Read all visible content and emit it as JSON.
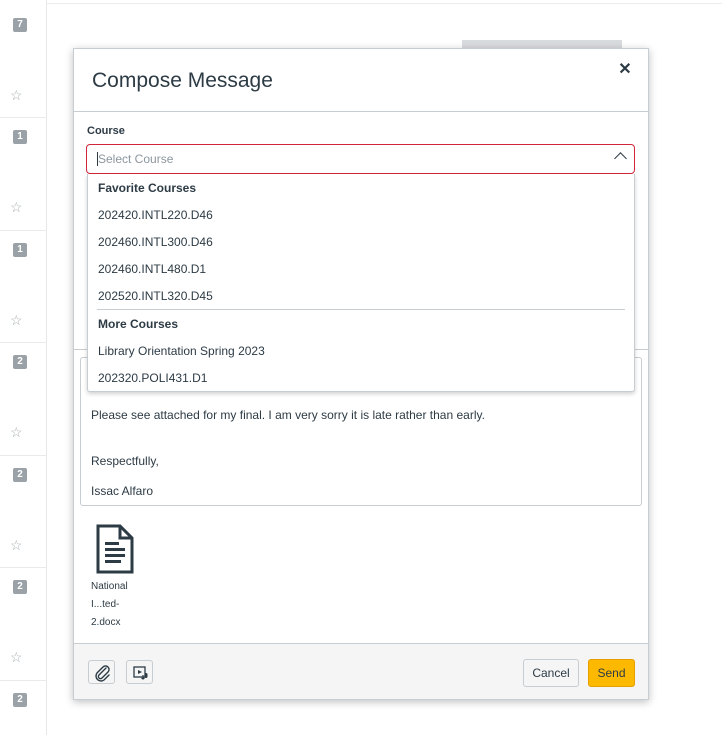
{
  "background": {
    "badges": [
      "7",
      "1",
      "1",
      "2",
      "2",
      "2",
      "2"
    ],
    "star_icon": "star-outline-icon"
  },
  "modal": {
    "title": "Compose Message",
    "close_icon": "close-icon"
  },
  "course": {
    "label": "Course",
    "placeholder": "Select Course"
  },
  "dropdown": {
    "groups": [
      {
        "label": "Favorite Courses",
        "items": [
          "202420.INTL220.D46",
          "202460.INTL300.D46",
          "202460.INTL480.D1",
          "202520.INTL320.D45"
        ]
      },
      {
        "label": "More Courses",
        "items": [
          "Library Orientation Spring 2023",
          "202320.POLI431.D1"
        ]
      }
    ]
  },
  "message": {
    "lines": [
      "Please see attached for my final. I am very sorry it is late rather than early.",
      "Respectfully,",
      "Issac Alfaro"
    ]
  },
  "attachment": {
    "icon": "document-icon",
    "name_lines": [
      "National",
      "I...ted-",
      "2.docx"
    ]
  },
  "footer": {
    "attach_icon": "paperclip-icon",
    "media_icon": "media-record-icon",
    "cancel_label": "Cancel",
    "send_label": "Send"
  },
  "colors": {
    "send_button": "#fcb900",
    "error_border": "#d0253b"
  }
}
